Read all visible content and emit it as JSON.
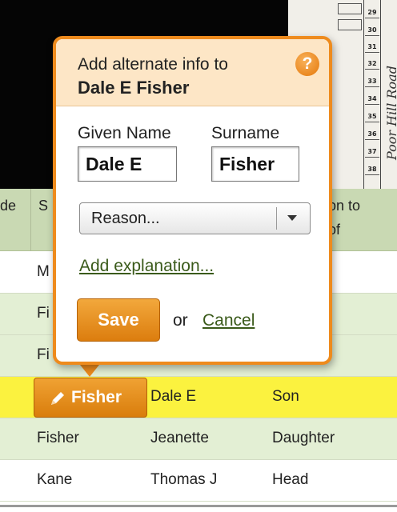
{
  "background": {
    "doc_numbers": [
      "29",
      "30",
      "31",
      "32",
      "33",
      "34",
      "35",
      "36",
      "37",
      "38"
    ],
    "doc_handwriting": "Poor Hill Road"
  },
  "table": {
    "headers": [
      "de",
      "S",
      "on to",
      "of"
    ],
    "rows": [
      {
        "surname": "M",
        "given": "",
        "relation": ""
      },
      {
        "surname": "Fi",
        "given": "",
        "relation": ""
      },
      {
        "surname": "Fi",
        "given": "",
        "relation": ""
      },
      {
        "surname": "Fisher",
        "given": "Dale E",
        "relation": "Son"
      },
      {
        "surname": "Fisher",
        "given": "Jeanette",
        "relation": "Daughter"
      },
      {
        "surname": "Kane",
        "given": "Thomas J",
        "relation": "Head"
      }
    ],
    "edit_pill_label": "Fisher",
    "colors": {
      "header_bg": "#c9d9b3",
      "row_green": "#e3efd4",
      "highlight": "#fbf23f"
    }
  },
  "popover": {
    "title_line1": "Add alternate info to",
    "title_line2": "Dale E Fisher",
    "help_label": "?",
    "given_label": "Given Name",
    "surname_label": "Surname",
    "given_value": "Dale E",
    "surname_value": "Fisher",
    "reason_placeholder": "Reason...",
    "explanation_link": "Add explanation...",
    "save_label": "Save",
    "or_text": "or",
    "cancel_label": "Cancel",
    "accent_color": "#ee8b1d"
  }
}
